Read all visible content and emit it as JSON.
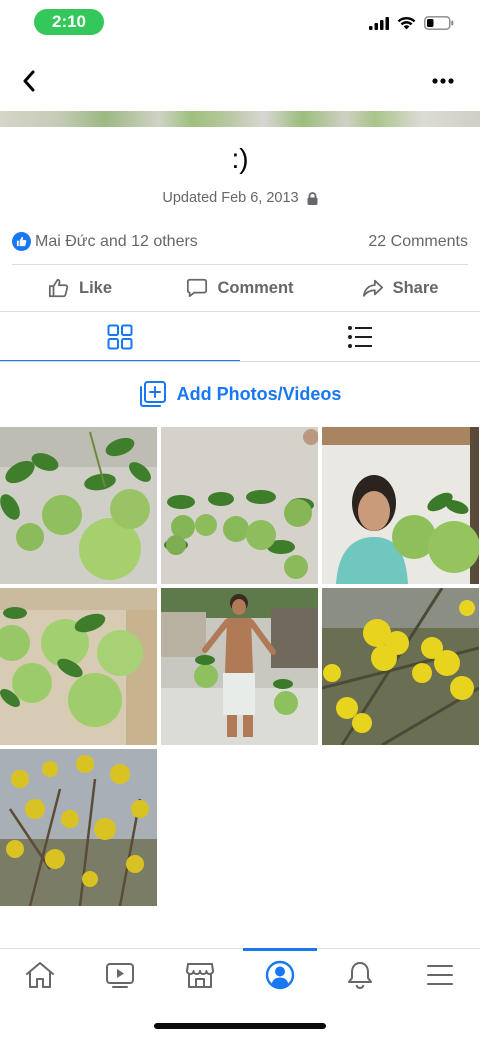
{
  "status_bar": {
    "time": "2:10",
    "icons": [
      "cellular-signal-icon",
      "wifi-icon",
      "battery-icon"
    ]
  },
  "nav": {
    "back_icon": "chevron-left-icon",
    "more_icon": "more-horizontal-icon"
  },
  "album": {
    "title": ":)",
    "updated": "Updated Feb 6, 2013",
    "privacy_icon": "lock-icon"
  },
  "reactions": {
    "text": "Mai Đức and 12 others",
    "comments": "22 Comments"
  },
  "actions": {
    "like": "Like",
    "comment": "Comment",
    "share": "Share"
  },
  "view_tabs": {
    "active": "grid",
    "items": [
      "grid-view-icon",
      "list-view-icon"
    ]
  },
  "add_photos": {
    "label": "Add Photos/Videos"
  },
  "photos": {
    "count": 7,
    "items": [
      {
        "subject": "pomelos-with-leaves-on-ground"
      },
      {
        "subject": "pomelos-lined-up-on-ground"
      },
      {
        "subject": "woman-holding-pomelos"
      },
      {
        "subject": "pomelos-in-box"
      },
      {
        "subject": "man-carrying-pomelos"
      },
      {
        "subject": "yellow-apricot-blossoms"
      },
      {
        "subject": "yellow-blossom-tree"
      }
    ]
  },
  "bottom_nav": {
    "active": "profile",
    "items": [
      "home-icon",
      "watch-icon",
      "marketplace-icon",
      "profile-icon",
      "notifications-icon",
      "menu-icon"
    ]
  },
  "colors": {
    "accent": "#1877f2",
    "text_secondary": "#65676b",
    "divider": "#dadde1",
    "status_pill": "#34c759"
  }
}
